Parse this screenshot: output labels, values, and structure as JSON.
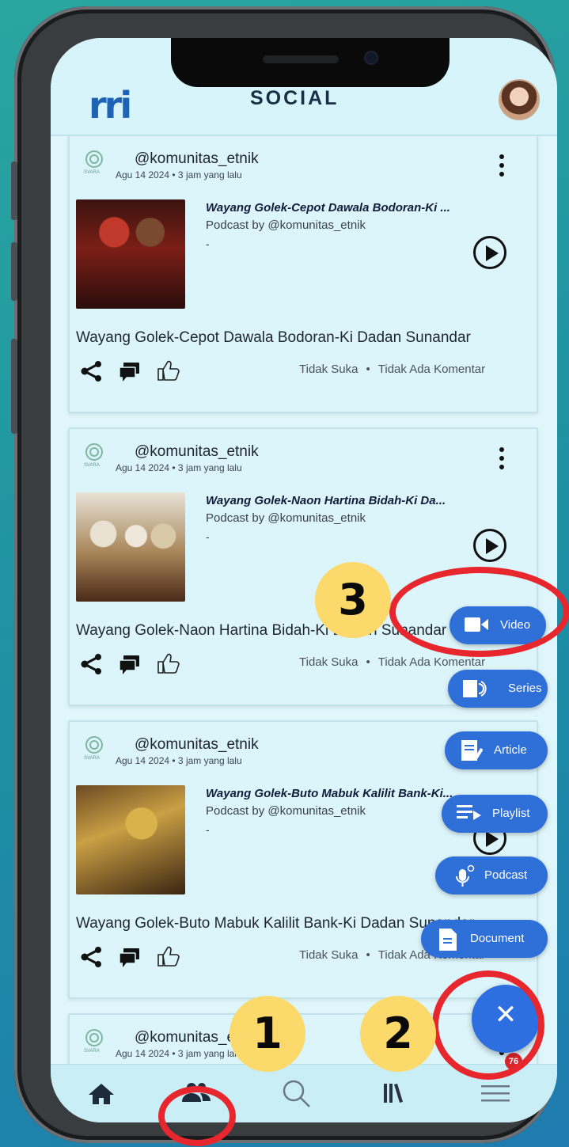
{
  "header": {
    "logo": "rri",
    "title": "SOCIAL"
  },
  "posts": [
    {
      "channel_logo_text": "SVARA",
      "user": "@komunitas_etnik",
      "meta": "Agu 14 2024 • 3 jam yang lalu",
      "podcast_title": "Wayang Golek-Cepot Dawala Bodoran-Ki ...",
      "podcast_by": "Podcast by @komunitas_etnik",
      "dash": "-",
      "description": "Wayang Golek-Cepot Dawala Bodoran-Ki Dadan Sunandar",
      "likes": "Tidak Suka",
      "comments": "Tidak Ada Komentar"
    },
    {
      "channel_logo_text": "SVARA",
      "user": "@komunitas_etnik",
      "meta": "Agu 14 2024 • 3 jam yang lalu",
      "podcast_title": "Wayang Golek-Naon Hartina Bidah-Ki Da...",
      "podcast_by": "Podcast by @komunitas_etnik",
      "dash": "-",
      "description": "Wayang Golek-Naon Hartina Bidah-Ki Dadan Sunandar",
      "likes": "Tidak Suka",
      "comments": "Tidak Ada Komentar"
    },
    {
      "channel_logo_text": "SVARA",
      "user": "@komunitas_etnik",
      "meta": "Agu 14 2024 • 3 jam yang lalu",
      "podcast_title": "Wayang Golek-Buto Mabuk Kalilit Bank-Ki...",
      "podcast_by": "Podcast by @komunitas_etnik",
      "dash": "-",
      "description": "Wayang Golek-Buto Mabuk Kalilit Bank-Ki Dadan Sunandar",
      "likes": "Tidak Suka",
      "comments": "Tidak Ada Komentar"
    },
    {
      "channel_logo_text": "SVARA",
      "user": "@komunitas_etnik",
      "meta": "Agu 14 2024 • 3 jam yang lalu"
    }
  ],
  "fab_menu": {
    "video": "Video",
    "series": "Series",
    "article": "Article",
    "playlist": "Playlist",
    "podcast": "Podcast",
    "document": "Document",
    "close_symbol": "✕"
  },
  "bottom_nav": {
    "items": [
      "home-icon",
      "community-icon",
      "search-icon",
      "library-icon",
      "menu-icon"
    ],
    "badge": "76"
  },
  "annotations": {
    "one": "1",
    "two": "2",
    "three": "3",
    "highlight_color": "#e8262e",
    "label_color": "#fbd96a"
  },
  "colors": {
    "accent": "#2e6fd8",
    "background": "#dff6fa",
    "logo": "#1f63b7"
  }
}
